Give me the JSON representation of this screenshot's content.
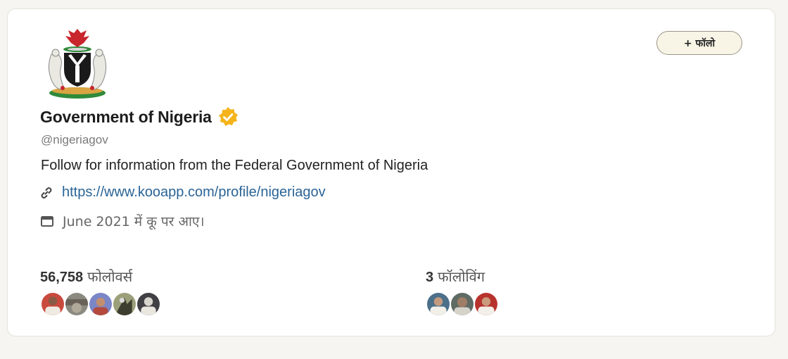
{
  "profile": {
    "display_name": "Government of Nigeria",
    "handle": "@nigeriagov",
    "bio": "Follow for information from the Federal Government of Nigeria",
    "link": "https://www.kooapp.com/profile/nigeriagov",
    "joined": "June 2021 में कू पर आए।",
    "verified": true,
    "verified_color": "#f4b41a"
  },
  "follow_button": {
    "label": "+ फॉलो"
  },
  "stats": {
    "followers": {
      "count": "56,758",
      "label": "फोलोवर्स"
    },
    "following": {
      "count": "3",
      "label": "फॉलोविंग"
    }
  },
  "icons": {
    "link": "link-icon",
    "calendar": "calendar-icon",
    "verified": "verified-badge-icon",
    "emblem": "coat-of-arms-emblem"
  },
  "colors": {
    "link": "#2a6496",
    "follow_button_bg": "#f8f5e6",
    "card_bg": "#ffffff",
    "page_bg": "#f6f5f1"
  }
}
